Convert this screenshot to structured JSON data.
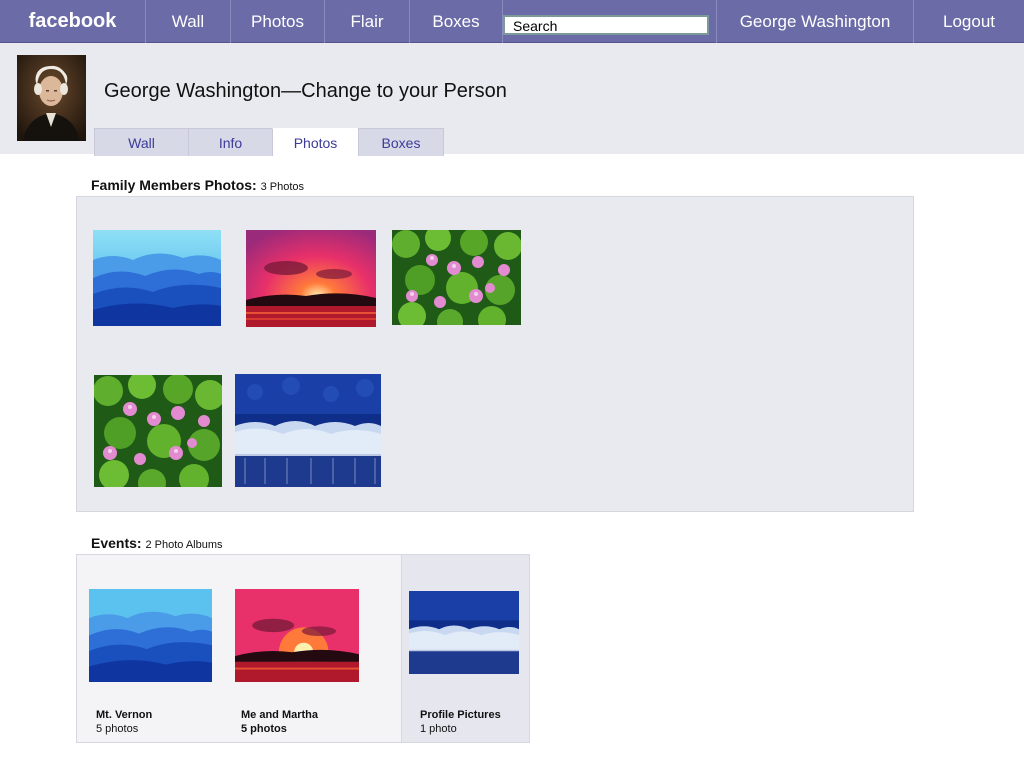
{
  "nav": {
    "logo": "facebook",
    "items": [
      "Wall",
      "Photos",
      "Flair",
      "Boxes"
    ],
    "search_placeholder": "Search",
    "user": "George Washington",
    "logout": "Logout"
  },
  "profile": {
    "title": "George Washington—Change to your Person",
    "tabs": [
      "Wall",
      "Info",
      "Photos",
      "Boxes"
    ],
    "active_tab": "Photos"
  },
  "family": {
    "heading": "Family Members Photos:",
    "count": "3 Photos"
  },
  "events": {
    "heading": "Events:",
    "count": "2 Photo Albums",
    "albums": [
      {
        "title": "Mt. Vernon",
        "count": "5 photos"
      },
      {
        "title": "Me and Martha",
        "count": "5 photos"
      },
      {
        "title": "Profile Pictures",
        "count": "1 photo"
      }
    ]
  },
  "colors": {
    "nav_bg": "#6b6ba8",
    "band_bg": "#e9eaf0",
    "tab_text": "#3b3b9a"
  }
}
